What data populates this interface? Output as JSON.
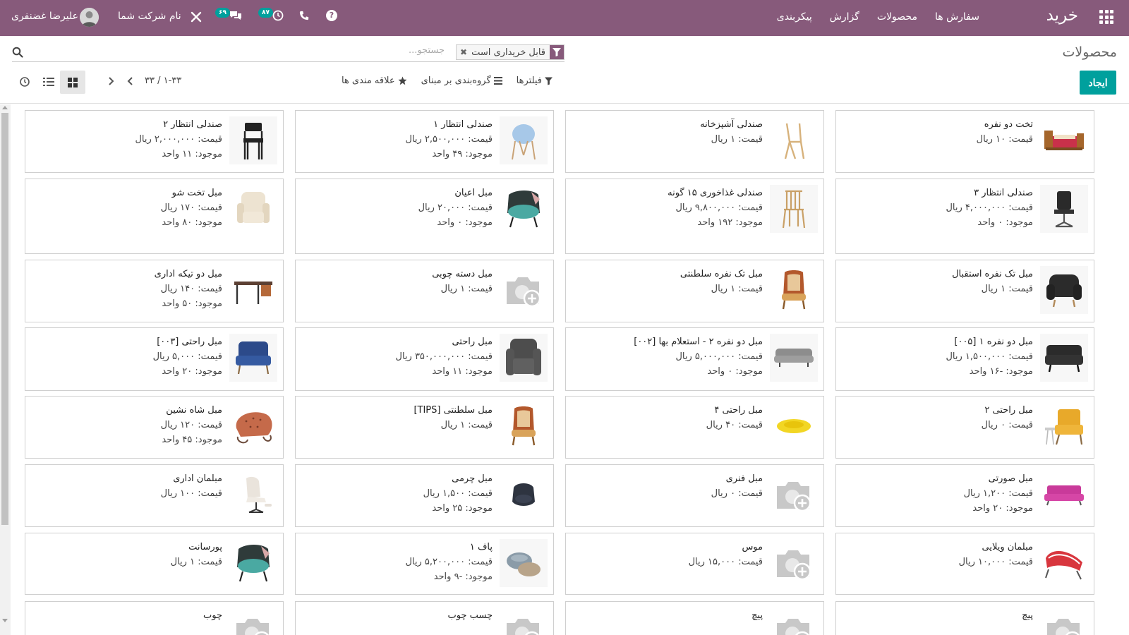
{
  "navbar": {
    "brand": "خرید",
    "menu": [
      "سفارش ها",
      "محصولات",
      "گزارش",
      "پیکربندی"
    ],
    "activity_count": "۸۷",
    "chat_count": "۶۹",
    "company": "نام شرکت شما",
    "user": "علیرضا غضنفری",
    "colors": {
      "bar": "#875a7b",
      "badge": "#00a09d"
    }
  },
  "control": {
    "breadcrumb": "محصولات",
    "facet_label": "قابل خریداری است",
    "search_placeholder": "جستجو...",
    "create_label": "ایجاد",
    "filters_label": "فیلترها",
    "groupby_label": "گروه‌بندی بر مبنای",
    "favorites_label": "علاقه مندی ها",
    "pager": "۱-۳۳ / ۳۳"
  },
  "products": [
    {
      "name": "تخت دو نفره",
      "price": "قیمت: ۱۰ ریال",
      "stock": "",
      "image": "bed"
    },
    {
      "name": "صندلی آشپزخانه",
      "price": "قیمت: ۱ ریال",
      "stock": "",
      "image": "wood-chair"
    },
    {
      "name": "صندلی انتظار ۱",
      "price": "قیمت: ۲,۵۰۰,۰۰۰ ریال",
      "stock": "موجود: ۴۹ واحد",
      "image": "blue-chair"
    },
    {
      "name": "صندلی انتظار ۲",
      "price": "قیمت: ۲,۰۰۰,۰۰۰ ریال",
      "stock": "موجود: ۱۱ واحد",
      "image": "black-chair"
    },
    {
      "name": "صندلی انتظار ۳",
      "price": "قیمت: ۴,۰۰۰,۰۰۰ ریال",
      "stock": "موجود: ۰ واحد",
      "image": "office-chair"
    },
    {
      "name": "صندلی غذاخوری ۱۵ گونه",
      "price": "قیمت: ۹,۸۰۰,۰۰۰ ریال",
      "stock": "موجود: ۱۹۲ واحد",
      "image": "dining-chair"
    },
    {
      "name": "مبل اعیان",
      "price": "قیمت: ۲۰,۰۰۰ ریال",
      "stock": "موجود: ۰ واحد",
      "image": "teal-armchair"
    },
    {
      "name": "مبل تخت شو",
      "price": "قیمت: ۱۷۰ ریال",
      "stock": "موجود: ۸۰ واحد",
      "image": "recliner"
    },
    {
      "name": "مبل تک نفره استقبال",
      "price": "قیمت: ۱ ریال",
      "stock": "",
      "image": "black-armchair"
    },
    {
      "name": "مبل تک نفره سلطنتی",
      "price": "قیمت: ۱ ریال",
      "stock": "",
      "image": "royal-chair"
    },
    {
      "name": "مبل دسته چوبی",
      "price": "قیمت: ۱ ریال",
      "stock": "",
      "image": "placeholder"
    },
    {
      "name": "مبل دو تیکه اداری",
      "price": "قیمت: ۱۴۰ ریال",
      "stock": "موجود: ۵۰ واحد",
      "image": "desk"
    },
    {
      "name": "مبل دو نفره ۱ [۰۰۵]",
      "price": "قیمت: ۱,۵۰۰,۰۰۰ ریال",
      "stock": "موجود: -۱۶ واحد",
      "image": "black-sofa"
    },
    {
      "name": "مبل دو نفره ۲ - استعلام بها [۰۰۲]",
      "price": "قیمت: ۵,۰۰۰,۰۰۰ ریال",
      "stock": "موجود: ۰ واحد",
      "image": "grey-sofa"
    },
    {
      "name": "مبل راحتی",
      "price": "قیمت: ۳۵۰,۰۰۰,۰۰۰ ریال",
      "stock": "موجود: ۱۱ واحد",
      "image": "grey-armchair"
    },
    {
      "name": "مبل راحتی [۰۰۳]",
      "price": "قیمت: ۵,۰۰۰ ریال",
      "stock": "موجود: ۲۰ واحد",
      "image": "blue-loveseat"
    },
    {
      "name": "مبل راحتی ۲",
      "price": "قیمت: ۰ ریال",
      "stock": "",
      "image": "yellow-armchair"
    },
    {
      "name": "مبل راحتی ۴",
      "price": "قیمت: ۴۰ ریال",
      "stock": "",
      "image": "yellow-sofa"
    },
    {
      "name": "مبل سلطنتی [TIPS]",
      "price": "قیمت: ۱ ریال",
      "stock": "",
      "image": "royal-chair"
    },
    {
      "name": "مبل شاه نشین",
      "price": "قیمت: ۱۲۰ ریال",
      "stock": "موجود: ۴۵ واحد",
      "image": "chesterfield"
    },
    {
      "name": "مبل صورتی",
      "price": "قیمت: ۱,۲۰۰ ریال",
      "stock": "موجود: ۲۰ واحد",
      "image": "pink-sofa"
    },
    {
      "name": "مبل فنری",
      "price": "قیمت: ۰ ریال",
      "stock": "",
      "image": "placeholder"
    },
    {
      "name": "مبل چرمی",
      "price": "قیمت: ۱,۵۰۰ ریال",
      "stock": "موجود: ۲۵ واحد",
      "image": "leather-chair"
    },
    {
      "name": "مبلمان اداری",
      "price": "قیمت: ۱۰۰ ریال",
      "stock": "",
      "image": "lounge-chair"
    },
    {
      "name": "مبلمان ویلایی",
      "price": "قیمت: ۱۰,۰۰۰ ریال",
      "stock": "",
      "image": "red-lounger"
    },
    {
      "name": "موس",
      "price": "قیمت: ۱۵,۰۰۰ ریال",
      "stock": "",
      "image": "placeholder"
    },
    {
      "name": "پاف ۱",
      "price": "قیمت: ۵,۲۰۰,۰۰۰ ریال",
      "stock": "موجود: -۹ واحد",
      "image": "poufs"
    },
    {
      "name": "پورسانت",
      "price": "قیمت: ۱ ریال",
      "stock": "",
      "image": "teal-armchair"
    },
    {
      "name": "پیچ",
      "price": "",
      "stock": "",
      "image": "placeholder"
    },
    {
      "name": "پیچ",
      "price": "",
      "stock": "",
      "image": "placeholder"
    },
    {
      "name": "چسب چوب",
      "price": "",
      "stock": "",
      "image": "placeholder"
    },
    {
      "name": "چوب",
      "price": "",
      "stock": "",
      "image": "placeholder"
    }
  ]
}
